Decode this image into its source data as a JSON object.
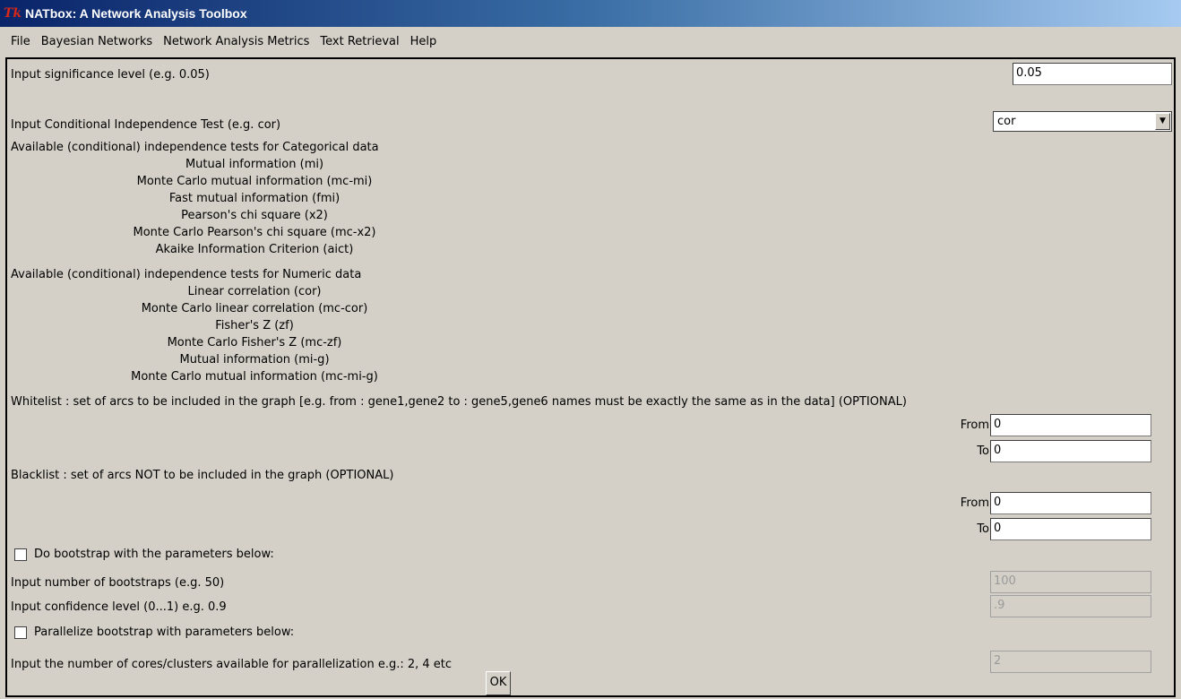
{
  "window": {
    "title": "NATbox: A Network Analysis Toolbox",
    "logo": "Tk"
  },
  "menu": [
    "File",
    "Bayesian Networks",
    "Network Analysis Metrics",
    "Text Retrieval",
    "Help"
  ],
  "significance": {
    "label": "Input significance level (e.g. 0.05)",
    "value": "0.05"
  },
  "ci_test": {
    "label": "Input Conditional Independence Test  (e.g. cor)",
    "value": "cor"
  },
  "categorical": {
    "heading": "Available (conditional) independence tests for Categorical data",
    "tests": [
      "Mutual information (mi)",
      "Monte Carlo mutual information (mc-mi)",
      "Fast mutual information (fmi)",
      "Pearson's chi square (x2)",
      "Monte Carlo Pearson's chi square (mc-x2)",
      "Akaike Information Criterion (aict)"
    ]
  },
  "numeric": {
    "heading": "Available (conditional) independence tests for Numeric data",
    "tests": [
      "Linear correlation (cor)",
      "Monte Carlo linear correlation (mc-cor)",
      "Fisher's Z (zf)",
      "Monte Carlo Fisher's Z (mc-zf)",
      "Mutual information (mi-g)",
      "Monte Carlo mutual information (mc-mi-g)"
    ]
  },
  "whitelist": {
    "label": "Whitelist : set of arcs to be included in the graph [e.g. from : gene1,gene2  to : gene5,gene6 names must be exactly the same as in the data] (OPTIONAL)",
    "from_label": "From",
    "from_value": "0",
    "to_label": "To",
    "to_value": "0"
  },
  "blacklist": {
    "label": "Blacklist : set of arcs NOT to be included in the graph (OPTIONAL)",
    "from_label": "From",
    "from_value": "0",
    "to_label": "To",
    "to_value": "0"
  },
  "bootstrap": {
    "checkbox_label": "Do bootstrap with the parameters below:",
    "checked": false,
    "num_label": "Input number of bootstraps (e.g. 50)",
    "num_value": "100",
    "conf_label": "Input confidence level (0...1) e.g. 0.9",
    "conf_value": ".9"
  },
  "parallel": {
    "checkbox_label": "Parallelize bootstrap with parameters below:",
    "checked": false,
    "cores_label": "Input the number of cores/clusters available for parallelization e.g.: 2, 4 etc",
    "cores_value": "2"
  },
  "ok_button": "OK",
  "icons": {
    "dropdown": "chevron-down-icon",
    "logo": "tk-logo-icon"
  }
}
